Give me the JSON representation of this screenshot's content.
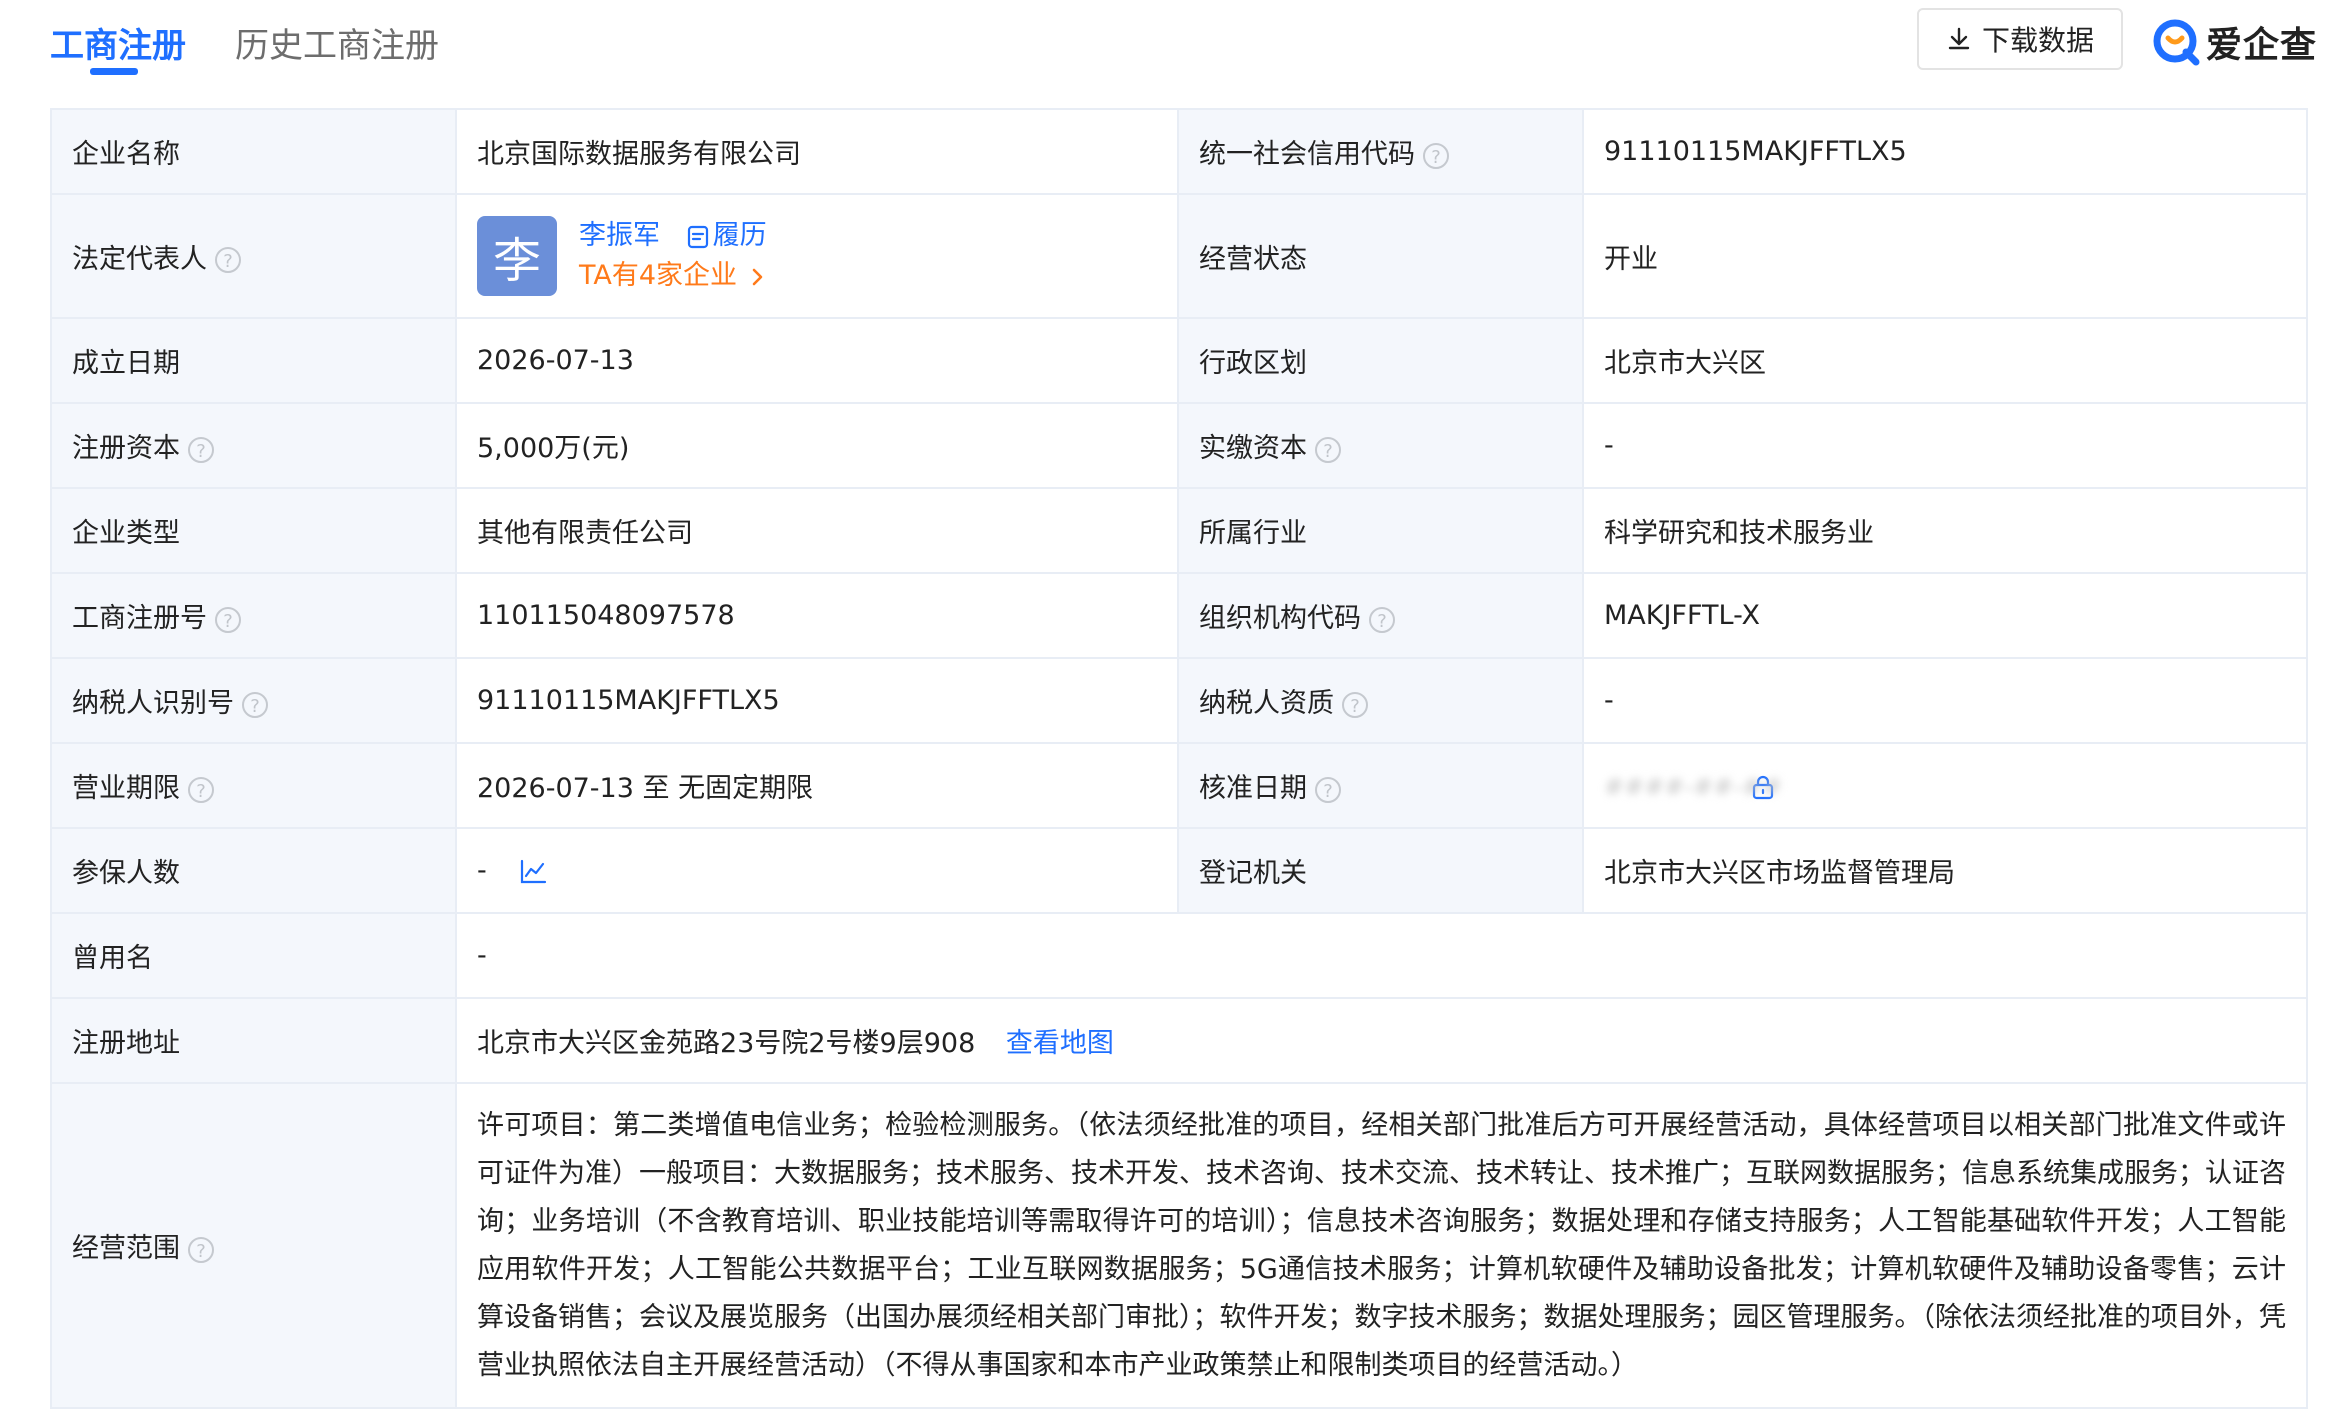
{
  "tabs": [
    {
      "label": "工商注册",
      "active": true
    },
    {
      "label": "历史工商注册",
      "active": false
    }
  ],
  "toolbar": {
    "download_label": "下载数据",
    "download_icon": "download-icon"
  },
  "brand": {
    "name": "爱企查",
    "color": "#1f6fff"
  },
  "colors": {
    "accent": "#1f6fff",
    "orange": "#ff7a1a",
    "label_bg": "#f4f7fc",
    "border": "#e8edf5",
    "avatar_bg": "#6b8fd9"
  },
  "fields": {
    "company_name": {
      "label": "企业名称",
      "value": "北京国际数据服务有限公司"
    },
    "credit_code": {
      "label": "统一社会信用代码",
      "value": "91110115MAKJFFTLX5"
    },
    "legal_rep": {
      "label": "法定代表人",
      "avatar_char": "李",
      "name": "李振军",
      "resume": "履历",
      "companies": "TA有4家企业"
    },
    "status": {
      "label": "经营状态",
      "value": "开业"
    },
    "est_date": {
      "label": "成立日期",
      "value": "2026-07-13"
    },
    "region": {
      "label": "行政区划",
      "value": "北京市大兴区"
    },
    "reg_capital": {
      "label": "注册资本",
      "value": "5,000万(元)"
    },
    "paid_capital": {
      "label": "实缴资本",
      "value": "-"
    },
    "type": {
      "label": "企业类型",
      "value": "其他有限责任公司"
    },
    "industry": {
      "label": "所属行业",
      "value": "科学研究和技术服务业"
    },
    "reg_no": {
      "label": "工商注册号",
      "value": "110115048097578"
    },
    "org_code": {
      "label": "组织机构代码",
      "value": "MAKJFFTL-X"
    },
    "tax_id": {
      "label": "纳税人识别号",
      "value": "91110115MAKJFFTLX5"
    },
    "taxpayer_qual": {
      "label": "纳税人资质",
      "value": "-"
    },
    "term": {
      "label": "营业期限",
      "value": "2026-07-13 至 无固定期限"
    },
    "approval_date": {
      "label": "核准日期",
      "value": "####-##-##"
    },
    "insured": {
      "label": "参保人数",
      "value": "-"
    },
    "authority": {
      "label": "登记机关",
      "value": "北京市大兴区市场监督管理局"
    },
    "former_name": {
      "label": "曾用名",
      "value": "-"
    },
    "address": {
      "label": "注册地址",
      "value": "北京市大兴区金苑路23号院2号楼9层908",
      "map_link": "查看地图"
    },
    "scope": {
      "label": "经营范围",
      "value": "许可项目：第二类增值电信业务；检验检测服务。（依法须经批准的项目，经相关部门批准后方可开展经营活动，具体经营项目以相关部门批准文件或许可证件为准）一般项目：大数据服务；技术服务、技术开发、技术咨询、技术交流、技术转让、技术推广；互联网数据服务；信息系统集成服务；认证咨询；业务培训（不含教育培训、职业技能培训等需取得许可的培训）；信息技术咨询服务；数据处理和存储支持服务；人工智能基础软件开发；人工智能应用软件开发；人工智能公共数据平台；工业互联网数据服务；5G通信技术服务；计算机软硬件及辅助设备批发；计算机软硬件及辅助设备零售；云计算设备销售；会议及展览服务（出国办展须经相关部门审批）；软件开发；数字技术服务；数据处理服务；园区管理服务。（除依法须经批准的项目外，凭营业执照依法自主开展经营活动）（不得从事国家和本市产业政策禁止和限制类项目的经营活动。）"
    }
  }
}
